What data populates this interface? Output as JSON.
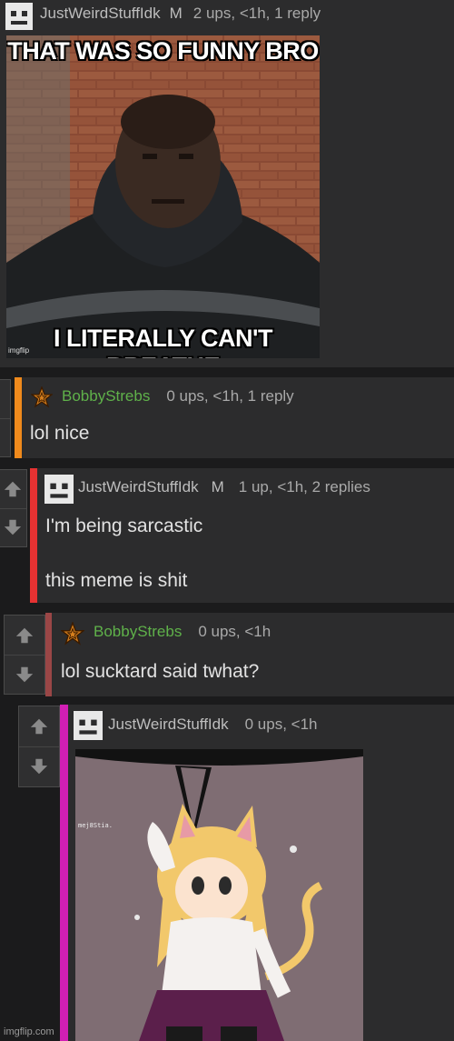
{
  "comments": [
    {
      "username": "JustWeirdStuffIdk",
      "mod_badge": "M",
      "stats": "2 ups, <1h, 1 reply",
      "meme": {
        "top_text": "THAT WAS SO FUNNY BRO",
        "bottom_text": "I LITERALLY CAN'T BREATHE",
        "watermark": "imgflip"
      }
    },
    {
      "username": "BobbyStrebs",
      "stats": "0 ups, <1h, 1 reply",
      "body": "lol nice",
      "bar_color": "#f08a1c"
    },
    {
      "username": "JustWeirdStuffIdk",
      "mod_badge": "M",
      "stats": "1 up, <1h, 2 replies",
      "body_line1": "I'm being sarcastic",
      "body_line2": "this meme is shit",
      "bar_color": "#e63232"
    },
    {
      "username": "BobbyStrebs",
      "stats": "0 ups, <1h",
      "body": "lol sucktard said twhat?",
      "bar_color": "#9a4646"
    },
    {
      "username": "JustWeirdStuffIdk",
      "stats": "0 ups, <1h",
      "bar_color": "#d21fb4",
      "image_caption": "mej8Stia."
    }
  ],
  "footer_watermark": "imgflip.com",
  "icons": {
    "upvote": "arrow-up-icon",
    "downvote": "arrow-down-icon",
    "star_avatar": "star-icon",
    "face_avatar": "robot-face-icon"
  },
  "colors": {
    "page_bg": "#1b1b1c",
    "panel_bg": "#2c2c2d",
    "username_green": "#5fb14a",
    "username_gray": "#bdbdbd"
  }
}
